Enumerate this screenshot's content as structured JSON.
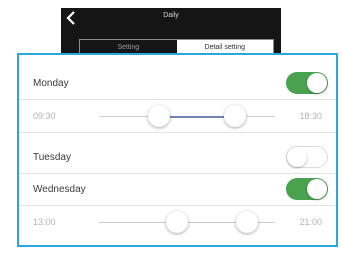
{
  "nav": {
    "title": "Daily",
    "back_icon": "chevron-left-icon"
  },
  "tabs": [
    {
      "label": "Setting",
      "active": false
    },
    {
      "label": "Detail setting",
      "active": true
    }
  ],
  "days": [
    {
      "name": "Monday",
      "enabled": true,
      "start": "09:30",
      "end": "18:30",
      "range_fraction": [
        0.42,
        0.84
      ]
    },
    {
      "name": "Tuesday",
      "enabled": false
    },
    {
      "name": "Wednesday",
      "enabled": true,
      "start": "13:00",
      "end": "21:00",
      "range_fraction": [
        0.54,
        0.9
      ]
    }
  ],
  "colors": {
    "toggle_on": "#4aa24f",
    "highlight_border": "#2aa7dc",
    "range_fill": "#6f86b5",
    "topbar": "#151515"
  }
}
